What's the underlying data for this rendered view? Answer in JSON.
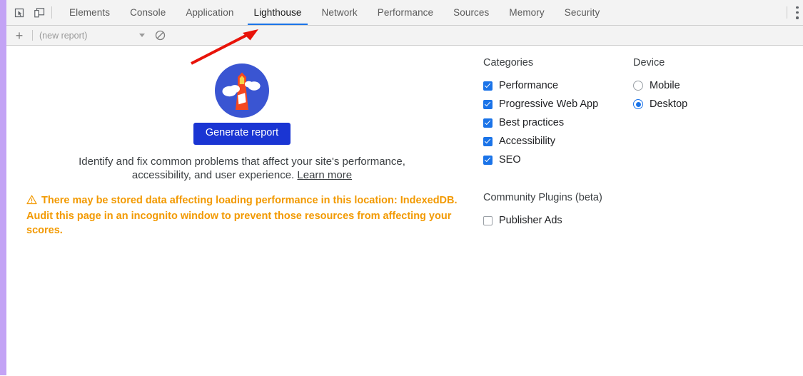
{
  "toolbar": {
    "inspect_icon": "inspect-cursor-icon",
    "device_toolbar_icon": "device-toolbar-icon",
    "tabs": [
      {
        "label": "Elements",
        "active": false
      },
      {
        "label": "Console",
        "active": false
      },
      {
        "label": "Application",
        "active": false
      },
      {
        "label": "Lighthouse",
        "active": true
      },
      {
        "label": "Network",
        "active": false
      },
      {
        "label": "Performance",
        "active": false
      },
      {
        "label": "Sources",
        "active": false
      },
      {
        "label": "Memory",
        "active": false
      },
      {
        "label": "Security",
        "active": false
      }
    ],
    "more_options_icon": "kebab-menu-icon",
    "active_tab_underline_color": "#1a73e8"
  },
  "actionbar": {
    "add_label": "+",
    "report_placeholder": "(new report)",
    "dropdown_icon": "chevron-down-icon",
    "clear_icon": "no-entry-clear-icon"
  },
  "start_view": {
    "logo_name": "lighthouse-logo",
    "generate_button": "Generate report",
    "subtitle_line1": "Identify and fix common problems that affect your site's performance,",
    "subtitle_line2": "accessibility, and user experience.",
    "learn_more": "Learn more",
    "warning_icon": "warning-triangle-icon",
    "warning_text": "There may be stored data affecting loading performance in this location: IndexedDB. Audit this page in an incognito window to prevent those resources from affecting your scores.",
    "warning_color": "#f29900",
    "button_color": "#1a35d3"
  },
  "settings": {
    "categories_title": "Categories",
    "categories": [
      {
        "label": "Performance",
        "checked": true
      },
      {
        "label": "Progressive Web App",
        "checked": true
      },
      {
        "label": "Best practices",
        "checked": true
      },
      {
        "label": "Accessibility",
        "checked": true
      },
      {
        "label": "SEO",
        "checked": true
      }
    ],
    "plugins_title": "Community Plugins (beta)",
    "plugins": [
      {
        "label": "Publisher Ads",
        "checked": false
      }
    ],
    "device_title": "Device",
    "devices": [
      {
        "label": "Mobile",
        "selected": false
      },
      {
        "label": "Desktop",
        "selected": true
      }
    ],
    "accent_color": "#1a73e8"
  },
  "annotation": {
    "arrow_name": "red-pointer-arrow",
    "arrow_color": "#e81309"
  }
}
